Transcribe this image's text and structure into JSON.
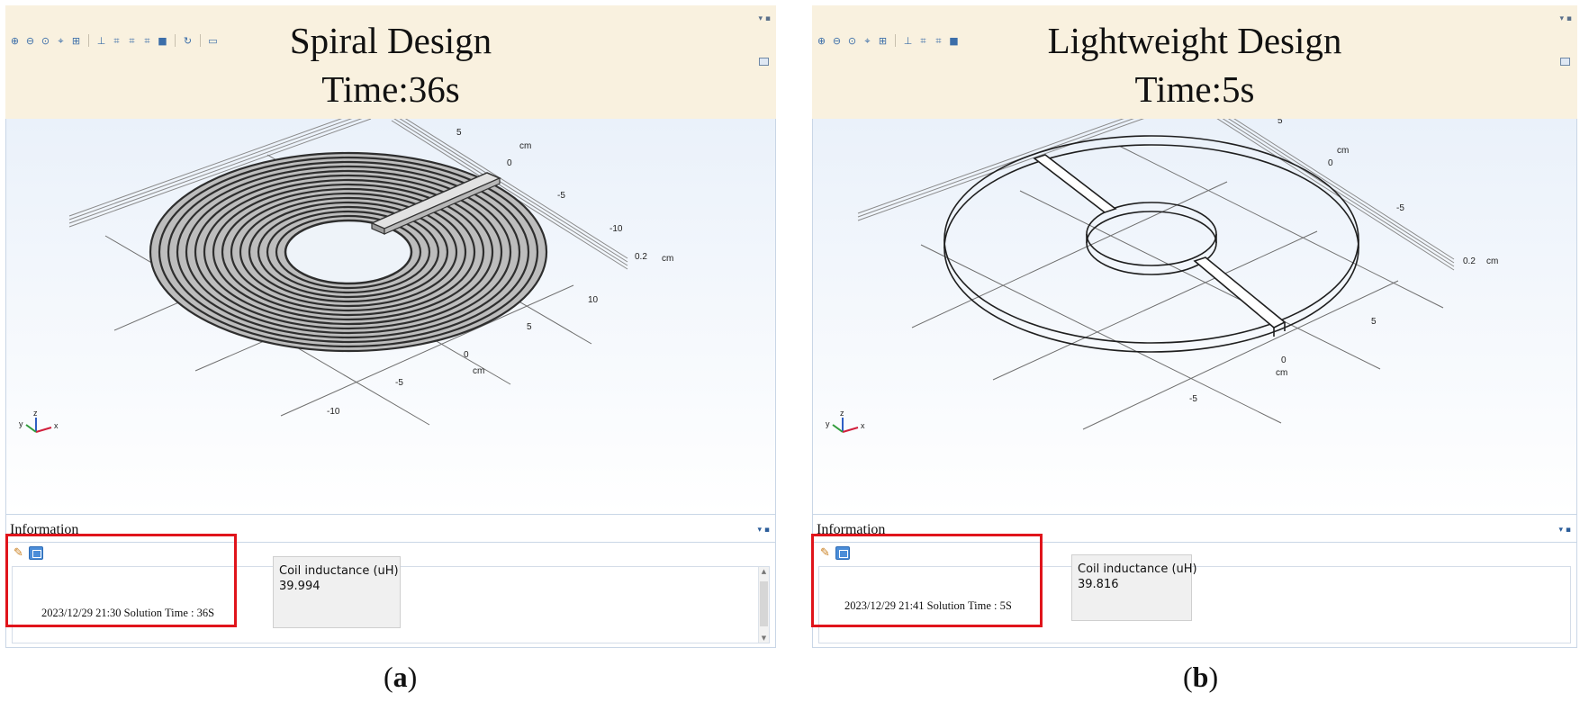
{
  "panels": [
    {
      "title_line1": "Spiral Design",
      "title_line2": "Time:36s",
      "axis_labels": {
        "back_10": "10",
        "back_5": "5",
        "back_cm": "cm",
        "back_0": "0",
        "back_m5": "-5",
        "back_m10": "-10",
        "z_02": "0.2",
        "z_cm": "cm",
        "front_10": "10",
        "front_5": "5",
        "front_0": "0",
        "front_cm": "cm",
        "front_m5": "-5",
        "front_m10": "-10"
      },
      "triad": {
        "z": "z",
        "y": "y",
        "x": "x"
      },
      "info_title": "Information",
      "log_line": "2023/12/29 21:30 Solution Time : 36S",
      "result_label": "Coil inductance (uH)",
      "result_value": "39.994",
      "caption_letter": "a"
    },
    {
      "title_line1": "Lightweight Design",
      "title_line2": "Time:5s",
      "axis_labels": {
        "back_5": "5",
        "back_cm": "cm",
        "back_0": "0",
        "back_m5": "-5",
        "z_02": "0.2",
        "z_cm": "cm",
        "front_5": "5",
        "front_0": "0",
        "front_cm": "cm",
        "front_m5": "-5"
      },
      "triad": {
        "z": "z",
        "y": "y",
        "x": "x"
      },
      "info_title": "Information",
      "log_line": "2023/12/29 21:41 Solution Time : 5S",
      "result_label": "Coil inductance (uH)",
      "result_value": "39.816",
      "caption_letter": "b"
    }
  ],
  "colors": {
    "toolbar_band": "#f9f1df",
    "highlight": "#e0141b",
    "triad_x": "#d11f3c",
    "triad_y": "#2f9c3a",
    "triad_z": "#2f5fc4"
  },
  "icons": [
    "zoom-in-icon",
    "zoom-out-icon",
    "zoom-box-icon",
    "zoom-extents-icon",
    "axis-icon",
    "view-xy-icon",
    "view-yz-icon",
    "view-zx-icon",
    "rotate-icon",
    "select-icon",
    "transparency-icon",
    "scene-light-icon",
    "camera-icon",
    "print-icon",
    "brush-icon",
    "clear-log-icon"
  ]
}
